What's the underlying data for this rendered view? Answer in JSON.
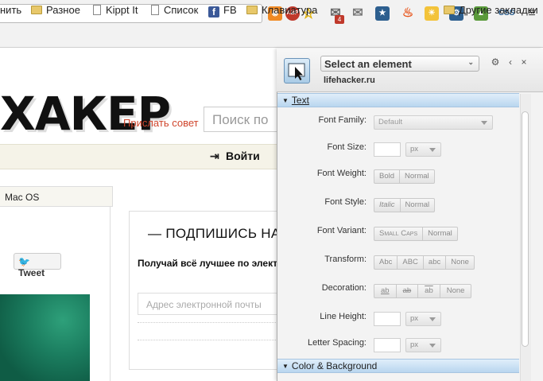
{
  "toolbar": {
    "extensions": [
      "rss-icon",
      "adblock-icon",
      "bookmark-star-icon",
      "mail-notifier-icon",
      "mail-icon",
      "star-extension-icon",
      "fire-icon",
      "sun-extension-icon",
      "gear-extension-icon",
      "evernote-icon",
      "css-extension-icon",
      "menu-icon"
    ],
    "adblock_label": "ABP",
    "mail_badge": "4",
    "css_label": "CSS"
  },
  "bookmarks": {
    "items": [
      {
        "label": "нить",
        "icon": "none"
      },
      {
        "label": "Разное",
        "icon": "folder-icon"
      },
      {
        "label": "Kippt It",
        "icon": "page-icon"
      },
      {
        "label": "Список",
        "icon": "page-icon"
      },
      {
        "label": "FB",
        "icon": "facebook-icon"
      },
      {
        "label": "Клавиатура",
        "icon": "folder-icon"
      }
    ],
    "other": "Другие закладки"
  },
  "page": {
    "logo": "ХАКЕР",
    "send_link": "Прислать совет",
    "search_placeholder": "Поиск по",
    "login": "Войти",
    "tab": "Mac OS",
    "tweet": "Tweet",
    "subscribe_title": "— ПОДПИШИСЬ НА Л",
    "subscribe_text": "Получай всё лучшее по элект",
    "email_placeholder": "Адрес электронной почты"
  },
  "inspector": {
    "select_label": "Select an element",
    "domain": "lifehacker.ru",
    "sections": {
      "text": "Text",
      "color": "Color & Background"
    },
    "fields": {
      "font_family": {
        "label": "Font Family:",
        "value": "Default"
      },
      "font_size": {
        "label": "Font Size:",
        "unit": "px"
      },
      "font_weight": {
        "label": "Font Weight:",
        "options": [
          "Bold",
          "Normal"
        ]
      },
      "font_style": {
        "label": "Font Style:",
        "options": [
          "Italic",
          "Normal"
        ]
      },
      "font_variant": {
        "label": "Font Variant:",
        "options": [
          "Small Caps",
          "Normal"
        ]
      },
      "transform": {
        "label": "Transform:",
        "options": [
          "Abc",
          "ABC",
          "abc",
          "None"
        ]
      },
      "decoration": {
        "label": "Decoration:",
        "options": [
          "ab",
          "ab",
          "ab",
          "None"
        ]
      },
      "line_height": {
        "label": "Line Height:",
        "unit": "px"
      },
      "letter_spacing": {
        "label": "Letter Spacing:",
        "unit": "px"
      }
    }
  }
}
